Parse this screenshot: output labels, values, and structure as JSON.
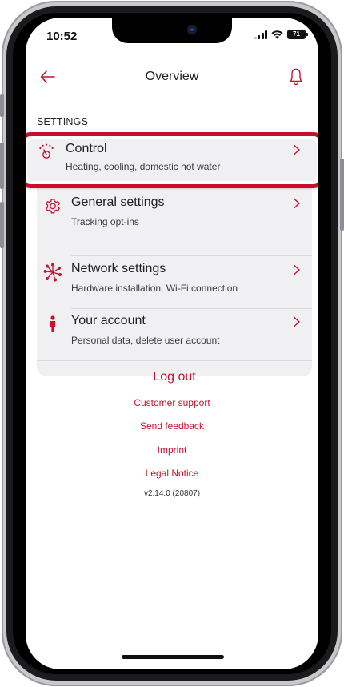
{
  "status_bar": {
    "time": "10:52",
    "battery": "71"
  },
  "header": {
    "title": "Overview"
  },
  "settings": {
    "section_label": "SETTINGS",
    "items": [
      {
        "title": "Control",
        "subtitle": "Heating, cooling, domestic hot water",
        "icon": "control-icon"
      },
      {
        "title": "General settings",
        "subtitle": "Tracking opt-ins",
        "icon": "gear-icon"
      },
      {
        "title": "Network settings",
        "subtitle": "Hardware installation, Wi-Fi connection",
        "icon": "network-icon"
      },
      {
        "title": "Your account",
        "subtitle": "Personal data, delete user account",
        "icon": "person-icon"
      }
    ],
    "logout_label": "Log out"
  },
  "links": [
    "Customer support",
    "Send feedback",
    "Imprint",
    "Legal Notice"
  ],
  "version": "v2.14.0 (20807)",
  "colors": {
    "accent": "#c8102e",
    "card_bg": "#f0eff2"
  }
}
